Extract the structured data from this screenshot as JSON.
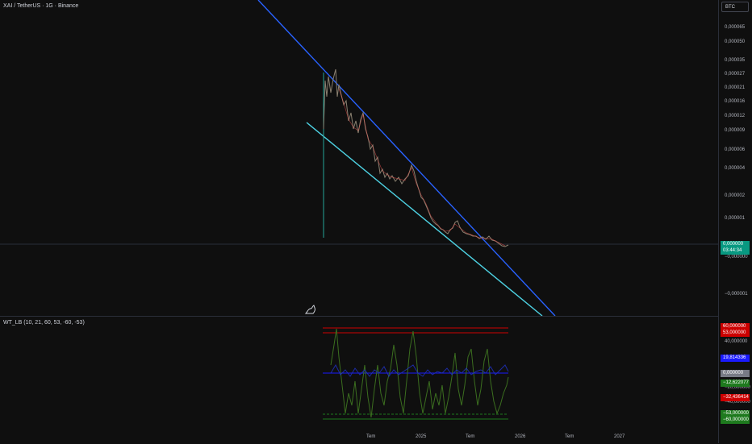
{
  "chart": {
    "title": "XAI / TetherUS · 1G · Binance",
    "currency_button": "BTC",
    "price_ticks": [
      "0,000065",
      "0,000050",
      "0,000035",
      "0,000027",
      "0,000021",
      "0,000016",
      "0,000012",
      "0,000009",
      "0,000006",
      "0,000004",
      "0,000002",
      "0,000001",
      "−0,000000",
      "−0,000001"
    ],
    "price_tag": {
      "value": "0,000000",
      "countdown": "03:44:34",
      "color": "#089981"
    }
  },
  "indicator": {
    "title": "WT_LB (10, 21, 60, 53, -60, -53)",
    "ticks": [
      "40,000000",
      "−20,000000",
      "−40,000000"
    ],
    "tags": [
      {
        "label": "60,000000",
        "color": "#cc0000"
      },
      {
        "label": "53,000000",
        "color": "#cc0000"
      },
      {
        "label": "19,814336",
        "color": "#1a1aff"
      },
      {
        "label": "0,000000",
        "color": "#787b86"
      },
      {
        "label": "−12,622077",
        "color": "#1e7a1e"
      },
      {
        "label": "−32,436414",
        "color": "#cc0000"
      },
      {
        "label": "−53,000000",
        "color": "#1e7a1e"
      },
      {
        "label": "−60,000000",
        "color": "#1e7a1e"
      }
    ]
  },
  "time_axis": [
    "Tem",
    "2025",
    "Tem",
    "2026",
    "Tem",
    "2027"
  ],
  "colors": {
    "upper_channel": "#2962ff",
    "lower_channel": "#4dd0e1",
    "candles_up": "#26a69a",
    "candles_down": "#ef5350"
  }
}
